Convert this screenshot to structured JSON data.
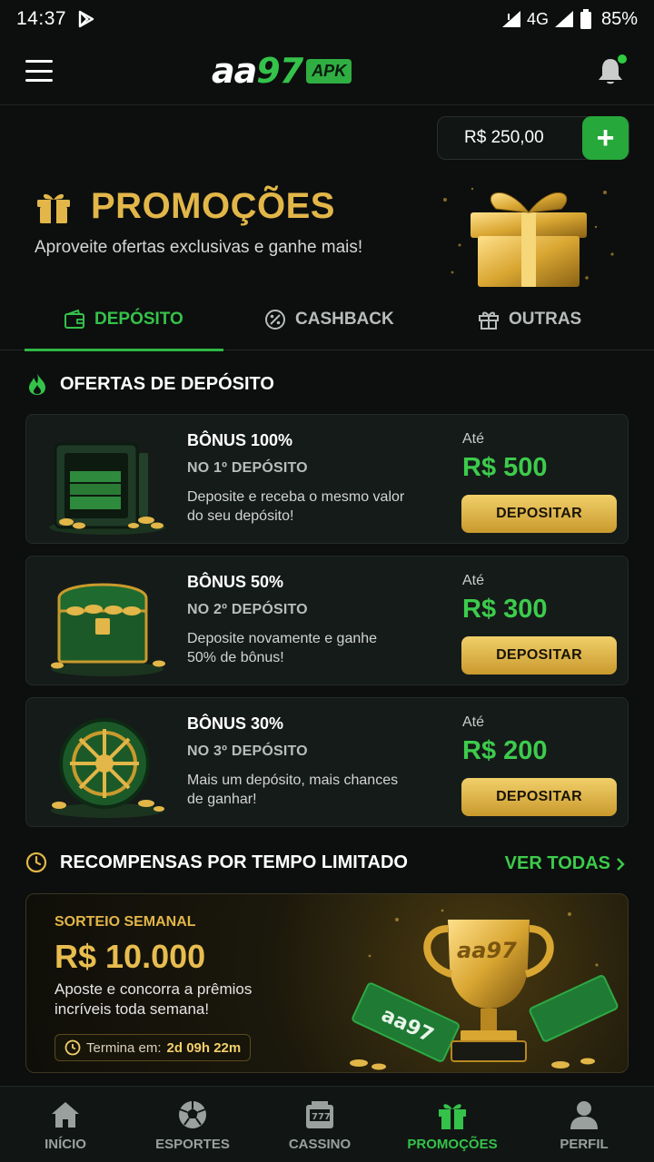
{
  "status_bar": {
    "time": "14:37",
    "network": "4G",
    "battery": "85%"
  },
  "header": {
    "logo_text_a": "aa",
    "logo_text_b": "97",
    "logo_badge": "APK"
  },
  "balance": {
    "amount": "R$ 250,00",
    "add_label": "+"
  },
  "hero": {
    "title": "PROMOÇÕES",
    "subtitle": "Aproveite ofertas exclusivas e ganhe mais!"
  },
  "tabs": [
    {
      "label": "DEPÓSITO",
      "icon": "wallet-icon",
      "active": true
    },
    {
      "label": "CASHBACK",
      "icon": "percent-icon",
      "active": false
    },
    {
      "label": "OUTRAS",
      "icon": "gift-icon",
      "active": false
    }
  ],
  "deposit_section": {
    "title": "OFERTAS DE DEPÓSITO",
    "offers": [
      {
        "title": "BÔNUS 100%",
        "subtitle": "NO 1º DEPÓSITO",
        "desc": "Deposite e receba o mesmo valor do seu depósito!",
        "upto": "Até",
        "value": "R$ 500",
        "button": "DEPOSITAR"
      },
      {
        "title": "BÔNUS 50%",
        "subtitle": "NO 2º DEPÓSITO",
        "desc": "Deposite novamente e ganhe 50% de bônus!",
        "upto": "Até",
        "value": "R$ 300",
        "button": "DEPOSITAR"
      },
      {
        "title": "BÔNUS 30%",
        "subtitle": "NO 3º DEPÓSITO",
        "desc": "Mais um depósito, mais chances de ganhar!",
        "upto": "Até",
        "value": "R$ 200",
        "button": "DEPOSITAR"
      }
    ]
  },
  "limited": {
    "title": "RECOMPENSAS POR TEMPO LIMITADO",
    "see_all": "VER TODAS",
    "banner": {
      "label": "SORTEIO SEMANAL",
      "amount": "R$ 10.000",
      "desc": "Aposte e concorra a prêmios incríveis toda semana!",
      "timer_label": "Termina em:",
      "timer_value": "2d 09h 22m",
      "trophy_text": "aa97",
      "ticket_text": "aa97"
    }
  },
  "bottom_nav": [
    {
      "label": "INÍCIO",
      "icon": "home-icon",
      "active": false
    },
    {
      "label": "ESPORTES",
      "icon": "soccer-ball-icon",
      "active": false
    },
    {
      "label": "CASSINO",
      "icon": "slot-machine-icon",
      "active": false
    },
    {
      "label": "PROMOÇÕES",
      "icon": "gift-icon",
      "active": true
    },
    {
      "label": "PERFIL",
      "icon": "user-icon",
      "active": false
    }
  ],
  "colors": {
    "accent_green": "#35c24a",
    "gold": "#e2b648",
    "background": "#0c0f0e",
    "card": "#151b19"
  }
}
